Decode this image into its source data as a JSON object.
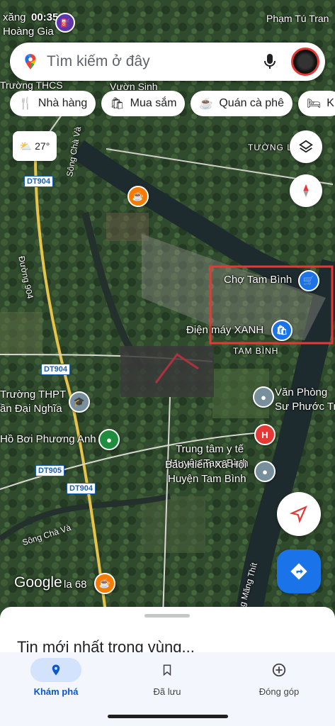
{
  "status_bar": {
    "top_left_1": "xăng",
    "top_left_2": "Hoàng Gia",
    "time": "00:35",
    "top_right": "Phạm Tú Tran"
  },
  "search": {
    "placeholder": "Tìm kiếm ở đây"
  },
  "chips": [
    {
      "icon": "restaurant-icon",
      "label": "Nhà hàng"
    },
    {
      "icon": "shopping-bag-icon",
      "label": "Mua sắm"
    },
    {
      "icon": "coffee-icon",
      "label": "Quán cà phê"
    },
    {
      "icon": "bed-icon",
      "label": "K"
    }
  ],
  "weather": {
    "temp": "27°"
  },
  "map_labels": {
    "thcs": "Trường THCS",
    "vuon_sinh": "Vườn Sinh",
    "tuong_loc": "TƯỜNG L",
    "song_cha_va_1": "Sông Chà Và",
    "song_cha_va_2": "Sông Chà Và",
    "duong904": "Đường 904",
    "cho_tam_binh": "Chợ Tam Bình",
    "dien_may_xanh": "Điện máy XANH",
    "tam_binh": "TAM BÌNH",
    "thpt_1": "Trường THPT",
    "thpt_2": "ần Đại Nghĩa",
    "ho_boi": "Hồ Bơi Phương Anh",
    "van_phong_1": "Văn Phòng",
    "van_phong_2": "Sư Phước Tr",
    "trung_tam_1": "Trung tâm y tế",
    "trung_tam_2": "Huyện Tam Bình",
    "bao_hiem_1": "Bảo Hiểm Xã Hội",
    "bao_hiem_2": "Huyện Tam Bình",
    "la68": "la 68",
    "mang_thit": "ng Măng Thít",
    "google": "Google"
  },
  "road_tags": [
    "DT904",
    "DT904",
    "DT905",
    "DT904"
  ],
  "sheet": {
    "title": "Tin mới nhất trong vùng..."
  },
  "nav": [
    {
      "icon": "location-pin-icon",
      "label": "Khám phá",
      "active": true
    },
    {
      "icon": "bookmark-icon",
      "label": "Đã lưu",
      "active": false
    },
    {
      "icon": "add-circle-icon",
      "label": "Đóng góp",
      "active": false
    }
  ],
  "colors": {
    "accent": "#1a73e8",
    "highlight_box": "#e53935"
  }
}
